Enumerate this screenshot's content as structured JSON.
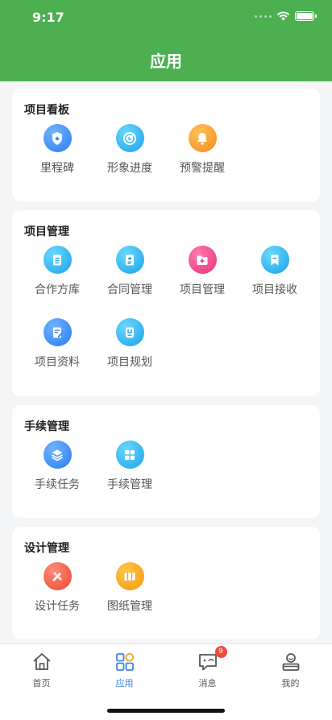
{
  "status": {
    "time": "9:17"
  },
  "header": {
    "title": "应用"
  },
  "sections": [
    {
      "title": "项目看板",
      "items": [
        {
          "label": "里程碑",
          "icon": "shield-icon"
        },
        {
          "label": "形象进度",
          "icon": "target-icon"
        },
        {
          "label": "预警提醒",
          "icon": "bell-icon"
        }
      ]
    },
    {
      "title": "项目管理",
      "items": [
        {
          "label": "合作方库",
          "icon": "clipboard-icon"
        },
        {
          "label": "合同管理",
          "icon": "contract-icon"
        },
        {
          "label": "项目管理",
          "icon": "folder-add-icon"
        },
        {
          "label": "项目接收",
          "icon": "bookmark-icon"
        },
        {
          "label": "项目资料",
          "icon": "document-edit-icon"
        },
        {
          "label": "项目规划",
          "icon": "planning-icon"
        }
      ]
    },
    {
      "title": "手续管理",
      "items": [
        {
          "label": "手续任务",
          "icon": "layers-icon"
        },
        {
          "label": "手续管理",
          "icon": "grid-icon"
        }
      ]
    },
    {
      "title": "设计管理",
      "items": [
        {
          "label": "设计任务",
          "icon": "design-tools-icon"
        },
        {
          "label": "图纸管理",
          "icon": "map-icon"
        }
      ]
    }
  ],
  "tabbar": [
    {
      "label": "首页",
      "icon": "home-icon"
    },
    {
      "label": "应用",
      "icon": "apps-icon",
      "active": true
    },
    {
      "label": "消息",
      "icon": "message-icon",
      "badge": "9"
    },
    {
      "label": "我的",
      "icon": "user-icon"
    }
  ],
  "colors": {
    "header": "#4caf50",
    "active_tab": "#3a86e8",
    "badge": "#f04a3c"
  }
}
